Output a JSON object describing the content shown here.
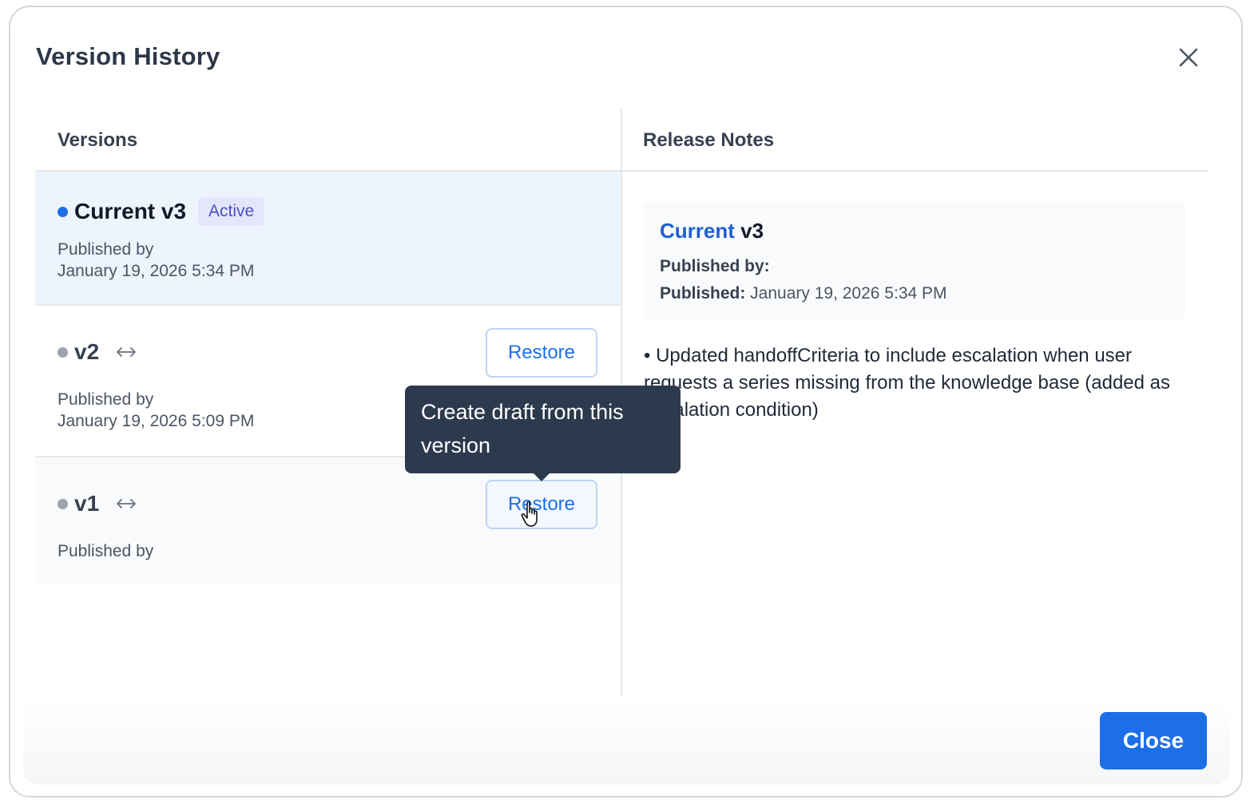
{
  "dialog": {
    "title": "Version History",
    "close_icon": "close-icon"
  },
  "versions_panel": {
    "header": "Versions",
    "items": [
      {
        "name": "Current v3",
        "badge": "Active",
        "status_color": "#1d6fe8",
        "published_by": "Published by",
        "published_at": "January 19, 2026 5:34 PM"
      },
      {
        "name": "v2",
        "compare_icon": "compare-arrows-icon",
        "published_by": "Published by",
        "published_at": "January 19, 2026 5:09 PM",
        "restore_label": "Restore"
      },
      {
        "name": "v1",
        "compare_icon": "compare-arrows-icon",
        "published_by": "Published by",
        "restore_label": "Restore"
      }
    ]
  },
  "tooltip": {
    "line1": "Create draft from this",
    "line2": "version"
  },
  "release_notes": {
    "header": "Release Notes",
    "card": {
      "title_link": "Current",
      "title_rest": " v3",
      "published_by_label": "Published by:",
      "published_label": "Published:",
      "published_value": " January 19, 2026 5:34 PM"
    },
    "body": "• Updated handoffCriteria to include escalation when user requests a series missing from the knowledge base (added as escalation condition)"
  },
  "footer": {
    "close_label": "Close"
  },
  "colors": {
    "accent": "#1d6fe8",
    "badge_bg": "#e4e7fb",
    "tooltip_bg": "#2d3a4e"
  }
}
